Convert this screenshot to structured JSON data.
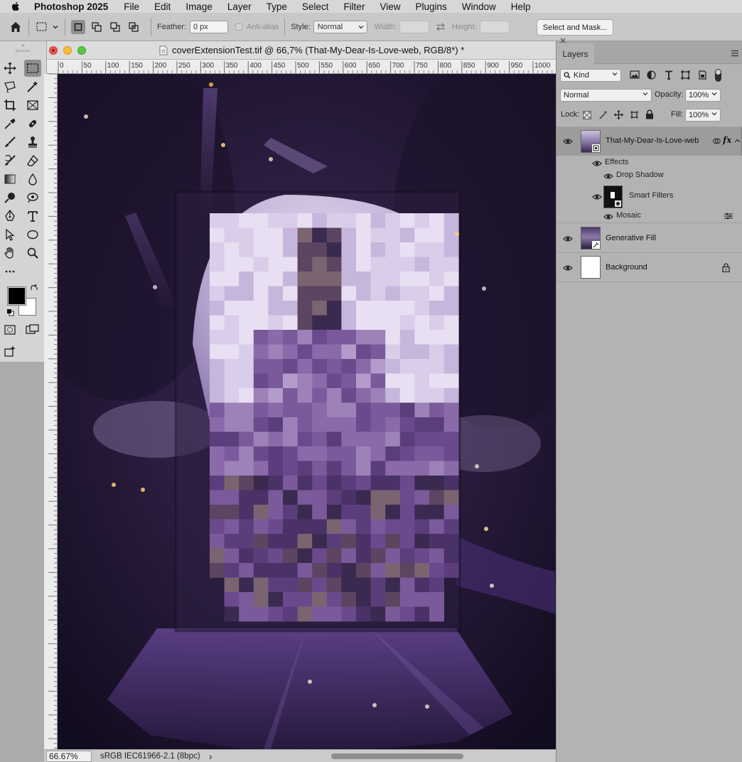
{
  "menubar": {
    "app_name": "Photoshop 2025",
    "items": [
      "File",
      "Edit",
      "Image",
      "Layer",
      "Type",
      "Select",
      "Filter",
      "View",
      "Plugins",
      "Window",
      "Help"
    ]
  },
  "options_bar": {
    "feather_label": "Feather:",
    "feather_value": "0 px",
    "anti_alias_label": "Anti-alias",
    "style_label": "Style:",
    "style_value": "Normal",
    "width_label": "Width:",
    "height_label": "Height:",
    "select_and_mask_label": "Select and Mask..."
  },
  "document": {
    "title": "coverExtensionTest.tif @ 66,7% (That-My-Dear-Is-Love-web, RGB/8*) *",
    "zoom": "66.67%",
    "color_profile": "sRGB IEC61966-2.1 (8bpc)",
    "status_arrow": "›",
    "ruler_top_labels": [
      "0",
      "50",
      "100",
      "150",
      "200",
      "250",
      "300",
      "350",
      "400",
      "450",
      "500",
      "550",
      "600",
      "650",
      "700",
      "750",
      "800",
      "850",
      "900",
      "950",
      "1000"
    ]
  },
  "layers_panel": {
    "tab_label": "Layers",
    "filter_kind": "Kind",
    "blend_mode": "Normal",
    "opacity_label": "Opacity:",
    "opacity_value": "100%",
    "lock_label": "Lock:",
    "fill_label": "Fill:",
    "fill_value": "100%",
    "layers": [
      {
        "name": "That-My-Dear-Is-Love-web",
        "selected": true
      },
      {
        "name": "Generative Fill",
        "selected": false
      },
      {
        "name": "Background",
        "selected": false
      }
    ],
    "effects_label": "Effects",
    "drop_shadow_label": "Drop Shadow",
    "smart_filters_label": "Smart Filters",
    "mosaic_label": "Mosaic",
    "fx_label": "fx"
  },
  "colors": {
    "canvas_dark": "#1a1329",
    "purple": "#6a4a8c",
    "selected_layer": "#9c9c9c"
  }
}
